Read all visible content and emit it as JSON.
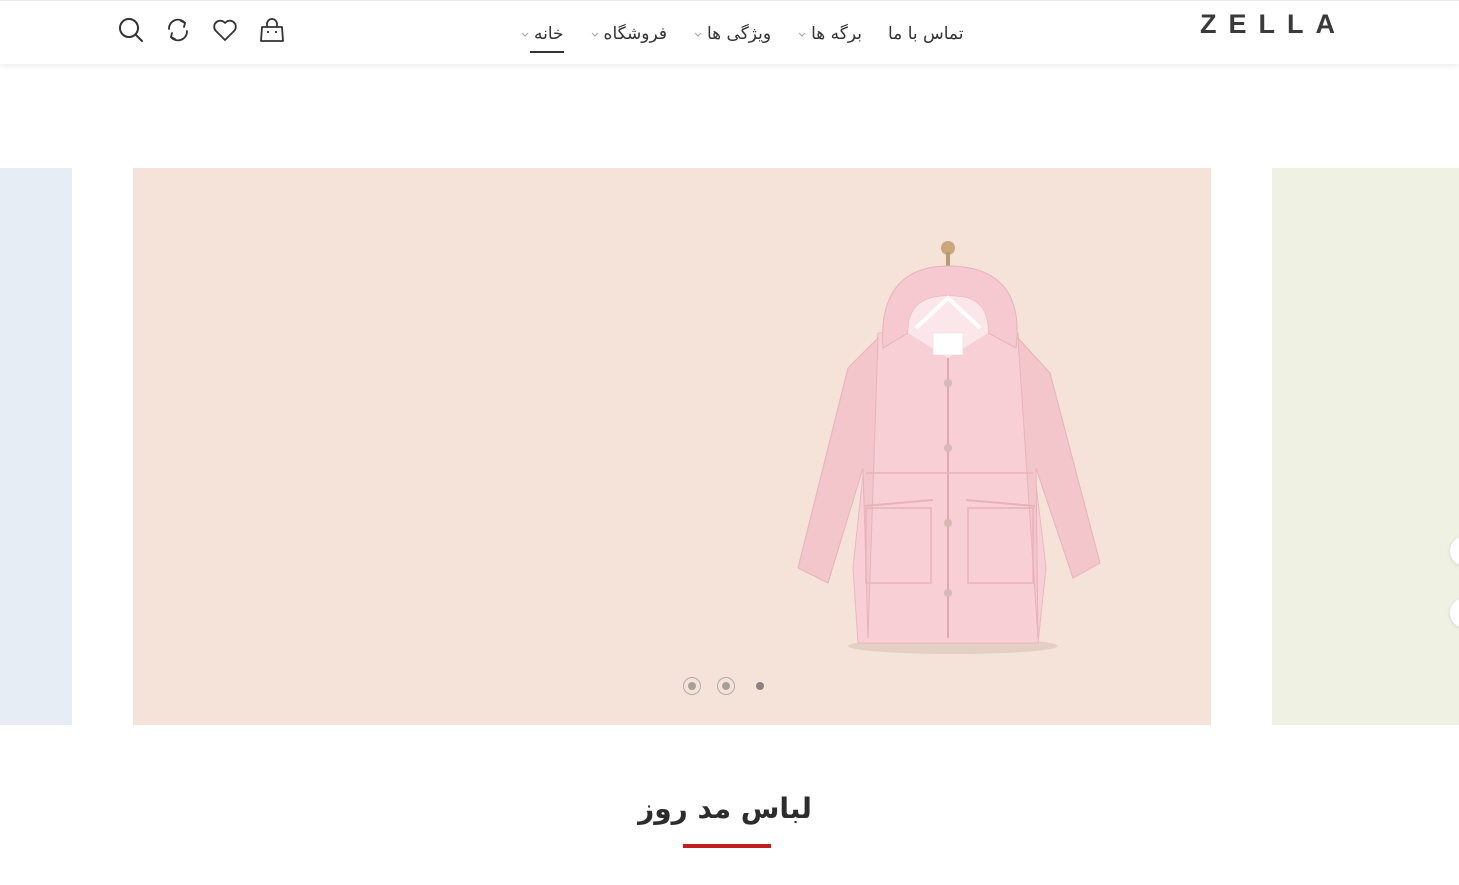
{
  "brand": {
    "logo": "ZELLA"
  },
  "nav": {
    "items": [
      {
        "label": "خانه",
        "active": true,
        "dropdown": true
      },
      {
        "label": "فروشگاه",
        "active": false,
        "dropdown": true
      },
      {
        "label": "ویژگی ها",
        "active": false,
        "dropdown": true
      },
      {
        "label": "برگه ها",
        "active": false,
        "dropdown": true
      },
      {
        "label": "تماس با ما",
        "active": false,
        "dropdown": false
      }
    ]
  },
  "header_icons": [
    "search-icon",
    "compare-icon",
    "heart-icon",
    "shopping-bag-icon"
  ],
  "slider": {
    "current_slide": 3,
    "total_slides": 3,
    "colors": {
      "main_slide": "#f5e3da",
      "prev_slide": "#e6edf4",
      "next_slide": "#eff2e2"
    }
  },
  "section": {
    "title": "لباس مد روز",
    "accent_color": "#c01f1f"
  }
}
